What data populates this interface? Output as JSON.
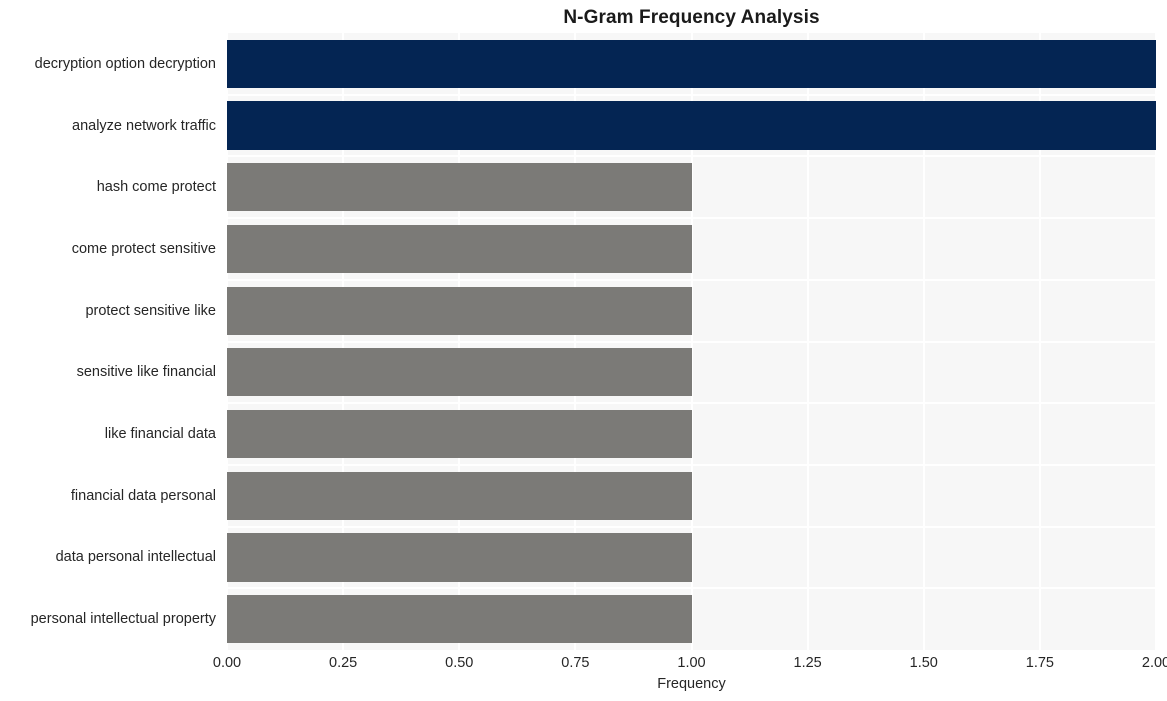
{
  "chart_data": {
    "type": "bar",
    "orientation": "horizontal",
    "title": "N-Gram Frequency Analysis",
    "xlabel": "Frequency",
    "ylabel": "",
    "xlim": [
      0,
      2
    ],
    "xticks": [
      "0.00",
      "0.25",
      "0.50",
      "0.75",
      "1.00",
      "1.25",
      "1.50",
      "1.75",
      "2.00"
    ],
    "xtick_values": [
      0,
      0.25,
      0.5,
      0.75,
      1.0,
      1.25,
      1.5,
      1.75,
      2.0
    ],
    "grid": true,
    "legend": "none",
    "categories": [
      "decryption option decryption",
      "analyze network traffic",
      "hash come protect",
      "come protect sensitive",
      "protect sensitive like",
      "sensitive like financial",
      "like financial data",
      "financial data personal",
      "data personal intellectual",
      "personal intellectual property"
    ],
    "values": [
      2,
      2,
      1,
      1,
      1,
      1,
      1,
      1,
      1,
      1
    ],
    "bar_colors": [
      "#042553",
      "#042553",
      "#7b7a77",
      "#7b7a77",
      "#7b7a77",
      "#7b7a77",
      "#7b7a77",
      "#7b7a77",
      "#7b7a77",
      "#7b7a77"
    ],
    "colors": {
      "highlight": "#042553",
      "normal": "#7b7a77",
      "plot_background": "#f7f7f7",
      "grid": "#ffffff",
      "figure_background": "#ffffff",
      "text": "#262626",
      "title": "#1a1a1a"
    }
  }
}
